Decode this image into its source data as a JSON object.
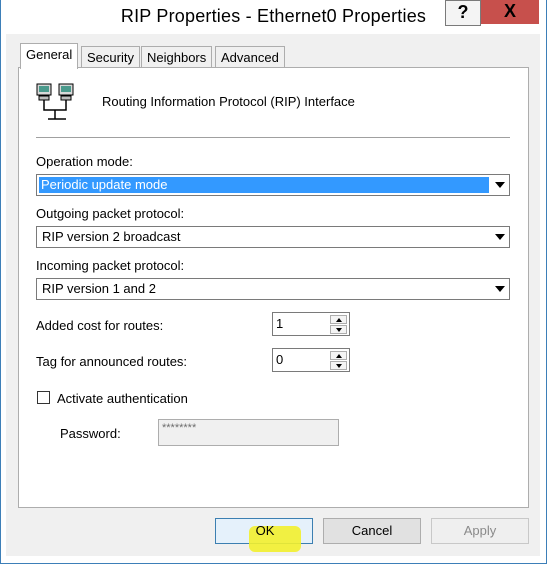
{
  "window": {
    "title": "RIP Properties - Ethernet0 Properties",
    "help_label": "?",
    "close_label": "X"
  },
  "tabs": [
    {
      "label": "General",
      "active": true
    },
    {
      "label": "Security",
      "active": false
    },
    {
      "label": "Neighbors",
      "active": false
    },
    {
      "label": "Advanced",
      "active": false
    }
  ],
  "general": {
    "icon": "network-computers-icon",
    "heading": "Routing Information Protocol (RIP) Interface",
    "operation_mode": {
      "label": "Operation mode:",
      "value": "Periodic update mode"
    },
    "outgoing": {
      "label": "Outgoing packet protocol:",
      "value": "RIP version 2 broadcast"
    },
    "incoming": {
      "label": "Incoming packet protocol:",
      "value": "RIP version 1 and 2"
    },
    "added_cost": {
      "label": "Added cost for routes:",
      "value": "1"
    },
    "tag": {
      "label": "Tag for announced routes:",
      "value": "0"
    },
    "auth": {
      "label": "Activate authentication",
      "checked": false
    },
    "password": {
      "label": "Password:",
      "value": "********"
    }
  },
  "buttons": {
    "ok": "OK",
    "cancel": "Cancel",
    "apply": "Apply"
  },
  "colors": {
    "selection": "#3399ff",
    "highlight": "#f2ef2d",
    "close_button": "#c7504c"
  }
}
